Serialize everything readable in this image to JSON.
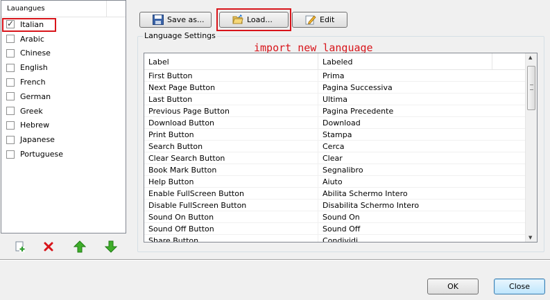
{
  "languages": {
    "header": "Lauangues",
    "items": [
      {
        "label": "Italian",
        "checked": true
      },
      {
        "label": "Arabic",
        "checked": false
      },
      {
        "label": "Chinese",
        "checked": false
      },
      {
        "label": "English",
        "checked": false
      },
      {
        "label": "French",
        "checked": false
      },
      {
        "label": "German",
        "checked": false
      },
      {
        "label": "Greek",
        "checked": false
      },
      {
        "label": "Hebrew",
        "checked": false
      },
      {
        "label": "Japanese",
        "checked": false
      },
      {
        "label": "Portuguese",
        "checked": false
      }
    ]
  },
  "toolbar": {
    "save_label": "Save as...",
    "load_label": "Load...",
    "edit_label": "Edit"
  },
  "settings": {
    "group_title": "Language Settings",
    "annotation": "import new language",
    "columns": [
      "Label",
      "Labeled"
    ],
    "rows": [
      [
        "First Button",
        "Prima"
      ],
      [
        "Next Page Button",
        "Pagina Successiva"
      ],
      [
        "Last Button",
        "Ultima"
      ],
      [
        "Previous Page Button",
        "Pagina Precedente"
      ],
      [
        "Download Button",
        "Download"
      ],
      [
        "Print Button",
        "Stampa"
      ],
      [
        "Search Button",
        "Cerca"
      ],
      [
        "Clear Search Button",
        "Clear"
      ],
      [
        "Book Mark Button",
        "Segnalibro"
      ],
      [
        "Help Button",
        "Aiuto"
      ],
      [
        "Enable FullScreen Button",
        "Abilita Schermo Intero"
      ],
      [
        "Disable FullScreen Button",
        "Disabilita Schermo Intero"
      ],
      [
        "Sound On Button",
        "Sound On"
      ],
      [
        "Sound Off Button",
        "Sound Off"
      ],
      [
        "Share Button",
        "Condividi"
      ]
    ]
  },
  "dialog": {
    "ok_label": "OK",
    "close_label": "Close"
  },
  "colors": {
    "highlight": "#d8141a",
    "accent": "#3c7fb1"
  }
}
